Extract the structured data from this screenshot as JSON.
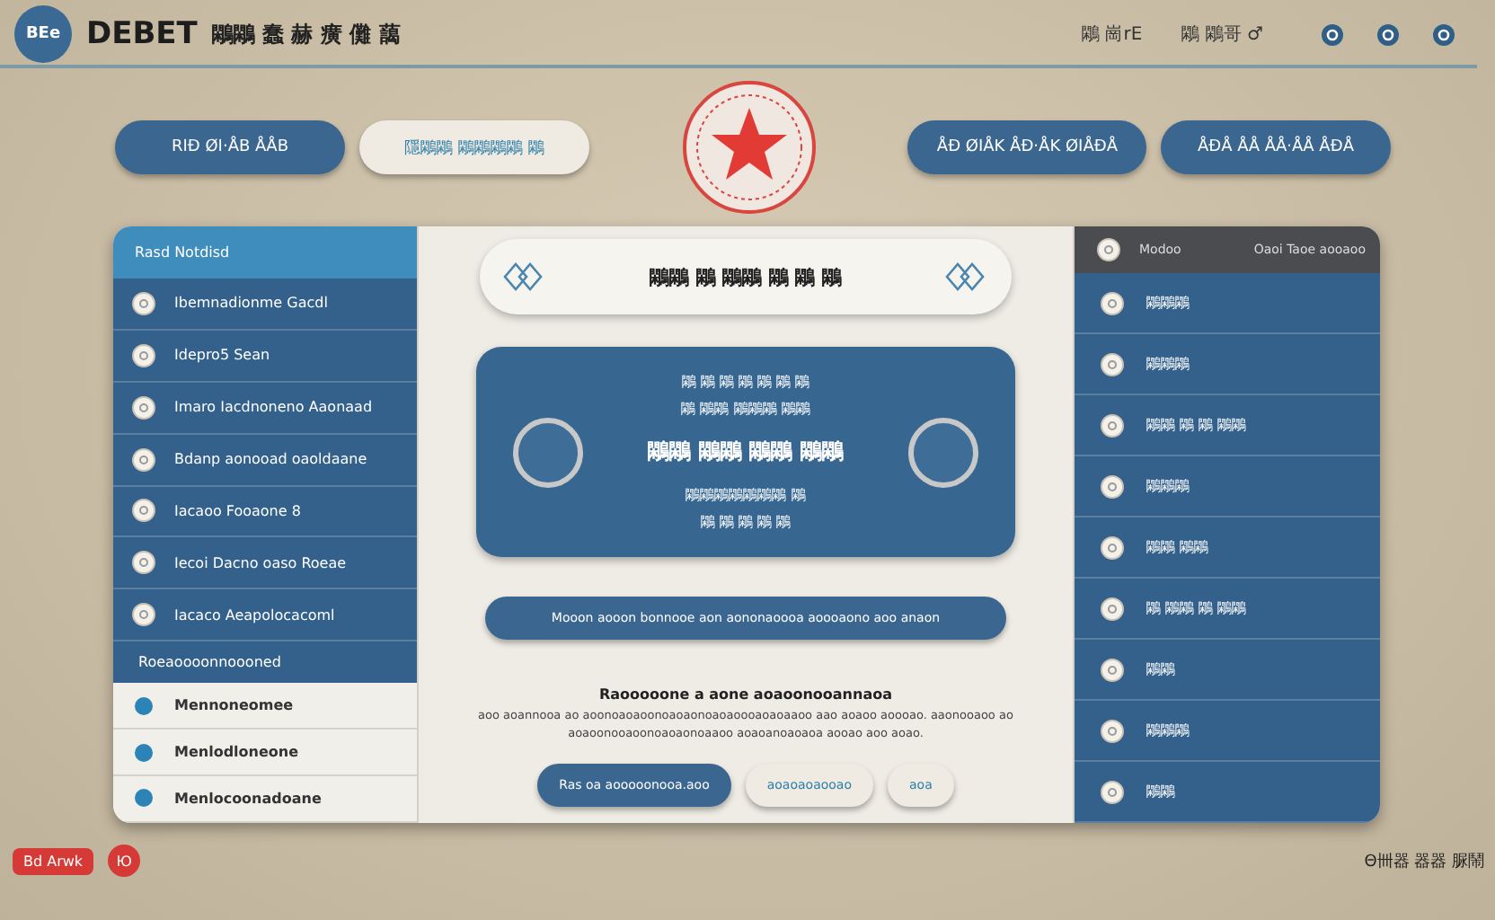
{
  "header": {
    "logo": "BEe",
    "title": "DEBET",
    "subtitle": "鷴鷴 蠢 赫 癀 儺 藹",
    "links": [
      "鷴 崗rE",
      "鷴 鷴哥 ♂"
    ]
  },
  "nav": {
    "left": [
      {
        "label": "RIÐ ØI·ÅB ÅÅB",
        "kind": "primary"
      },
      {
        "label": "隱鷴鷴 鷴鷴鷴鷴 鷴",
        "kind": "secondary"
      }
    ],
    "right": [
      {
        "label": "ÅÐ ØIÅK ÅÐ·ÅK ØIÅÐÅ",
        "kind": "primary"
      },
      {
        "label": "ÅÐÅ ÅÅ ÅÅ·ÅÅ ÅÐÅ",
        "kind": "primary"
      }
    ]
  },
  "sidebar": {
    "header": "Rasd Notdisd",
    "items": [
      "Ibemnadionme Gacdl",
      "Idepro5 Sean",
      "Imaro Iacdnoneno Aaonaad",
      "Bdanp aonooad oaoldaane",
      "Iacaoo Fooaone 8",
      "Iecoi Dacno oaso Roeae",
      "Iacaco Aeapolocacoml"
    ],
    "group": {
      "label": "Roeaoooonnoooned",
      "items": [
        "Mennoneomee",
        "Menlodloneone",
        "Menlocoonadoane"
      ]
    }
  },
  "main": {
    "title": "鷴鷴 鷴 鷴鷴 鷴 鷴 鷴",
    "card": {
      "line_1": "鷴 鷴 鷴 鷴 鷴 鷴 鷴",
      "line_2": "鷴 鷴鷴 鷴鷴鷴 鷴鷴",
      "headline": "鷴鷴 鷴鷴   鷴鷴 鷴鷴",
      "line_3": "鷴鷴鷴鷴鷴鷴鷴 鷴",
      "line_4": "鷴 鷴 鷴 鷴 鷴"
    },
    "bar": "Mooon aooon bonnooe aon aononaoooa aoooaono aoo anaon",
    "paragraph_title": "Raooooone a aone aoaoonooannaoa",
    "paragraph": "aoo aoannooa ao aoonoaoaoonoaoaonoaoaoooaoaoaaoo aao aoaoo aoooao. aaonooaoo ao aoaoonooaoonoaoaonoaaoo aoaoanoaoaoa aooao aoo aoao.",
    "buttons": [
      {
        "label": "Ras oa aooooonooa.aoo",
        "kind": "primary"
      },
      {
        "label": "aoaoaoaooao",
        "kind": "secondary"
      },
      {
        "label": "aoa",
        "kind": "secondary"
      }
    ]
  },
  "right_panel": {
    "header": "Modoo",
    "header_right": "Oaoi Taoe aooaoo",
    "items": [
      "鷴鷴鷴",
      "鷴鷴鷴",
      "鷴鷴 鷴 鷴 鷴鷴",
      "鷴鷴鷴",
      "鷴鷴 鷴鷴",
      "鷴 鷴鷴 鷴 鷴鷴",
      "鷴鷴",
      "鷴鷴鷴",
      "鷴鷴"
    ]
  },
  "footer": {
    "badge": "Bd Arwk",
    "badge_2": "Ю",
    "caption": "Θ卌器 器器 脲鬧"
  }
}
